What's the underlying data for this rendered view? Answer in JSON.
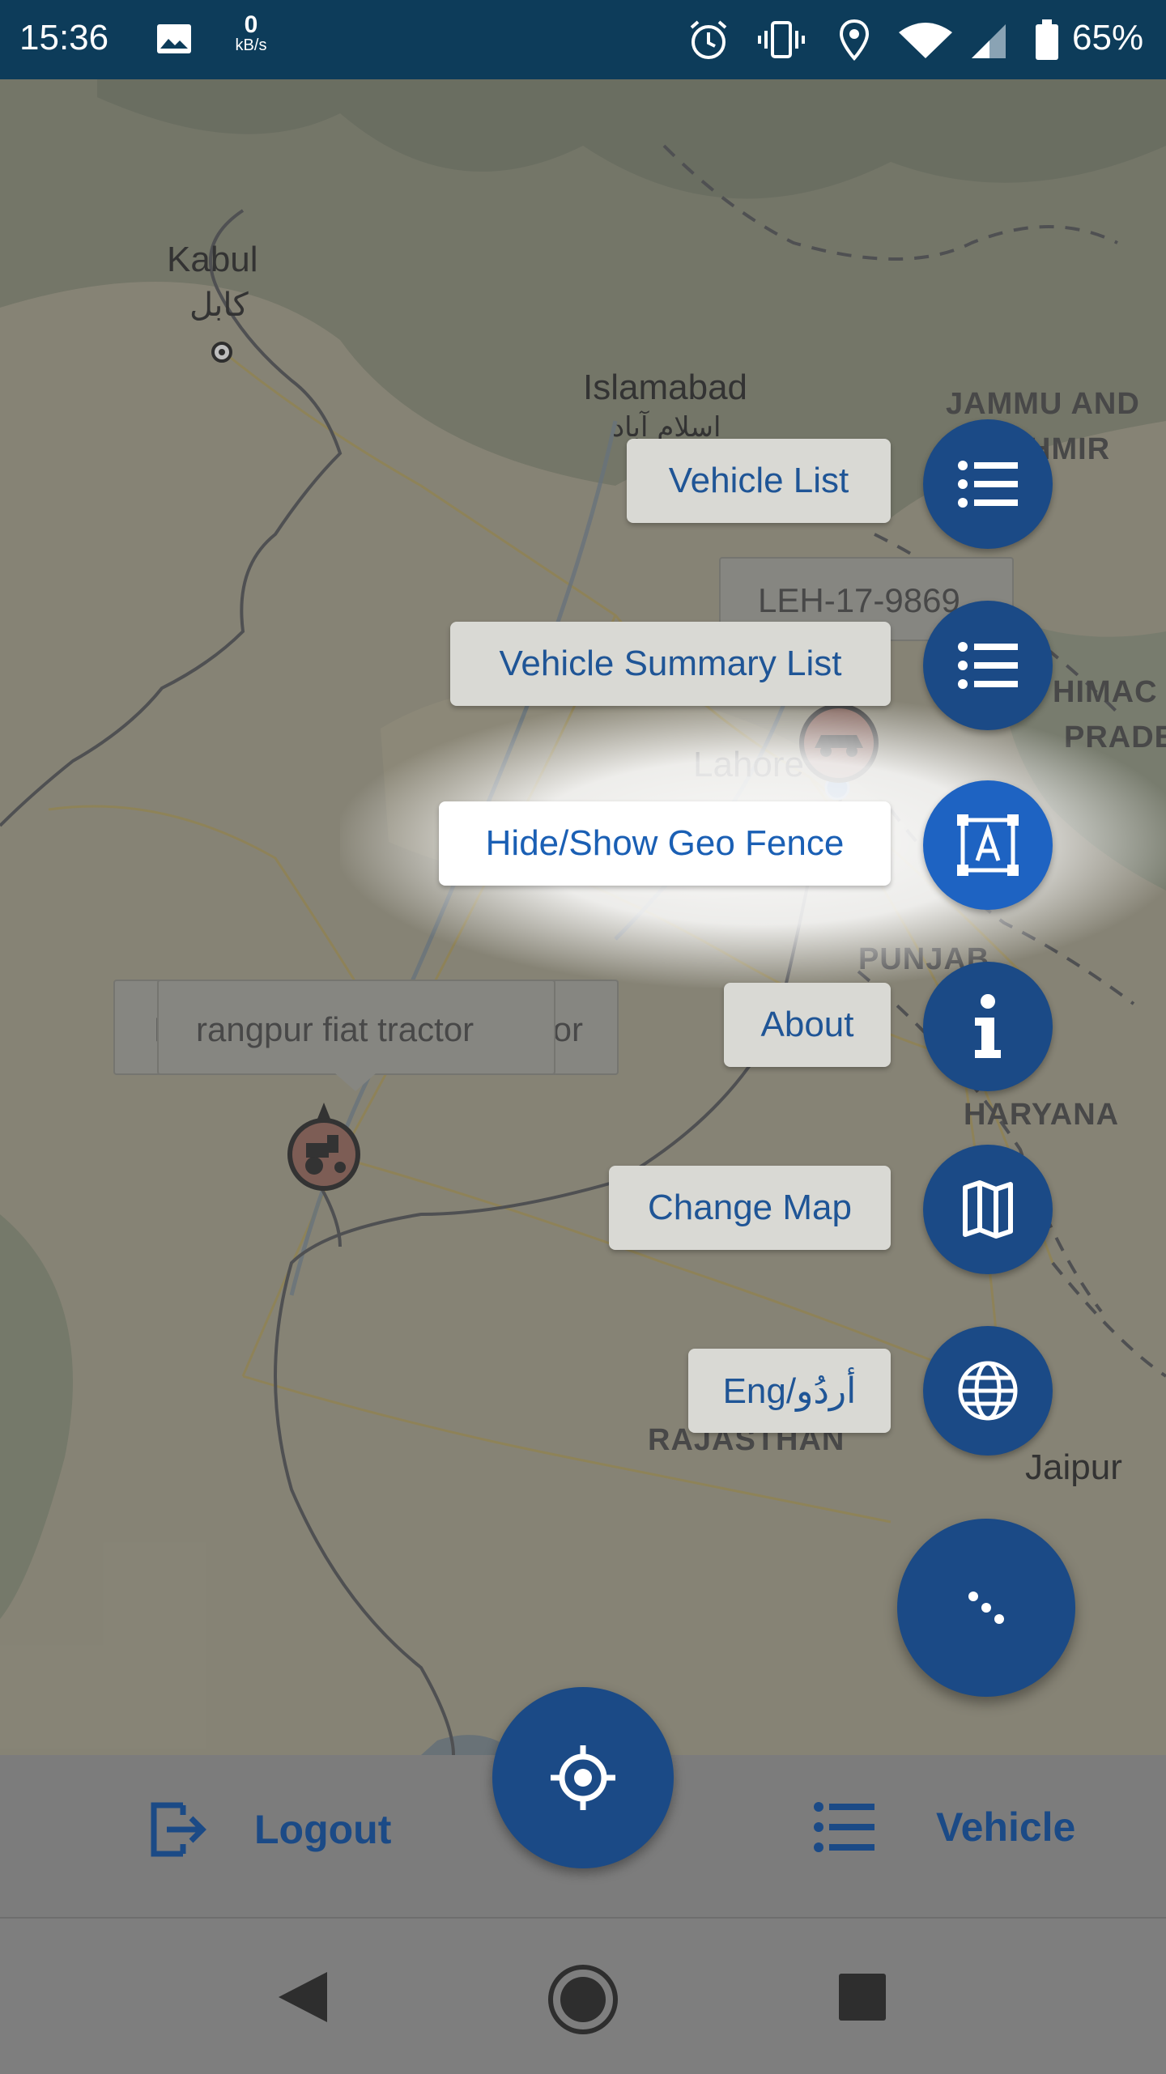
{
  "status_bar": {
    "time": "15:36",
    "net_speed_value": "0",
    "net_speed_unit": "kB/s",
    "battery": "65%",
    "icons": [
      "image-icon",
      "alarm-icon",
      "vibrate-icon",
      "location-icon",
      "wifi-icon",
      "signal-icon",
      "battery-icon"
    ]
  },
  "map": {
    "cities": {
      "kabul": "Kabul",
      "kabul_urdu": "کابل",
      "islamabad": "Islamabad",
      "islamabad_urdu": "اسلام آباد",
      "lahore": "Lahore",
      "jaipur": "Jaipur"
    },
    "regions": {
      "jammu1": "JAMMU AND",
      "jammu2": "HMIR",
      "himac1": "HIMAC",
      "himac2": "PRADE",
      "punjab": "PUNJAB",
      "haryana": "HARYANA",
      "rajasthan": "RAJASTHAN"
    },
    "vehicle_tooltip": "rangpur fiat tractor",
    "vehicle_tooltip_back_left": "F",
    "vehicle_tooltip_back_right": "or",
    "plate_tooltip": "LEH-17-9869"
  },
  "speed_dial": {
    "items": [
      {
        "label": "Vehicle List",
        "icon": "list-icon"
      },
      {
        "label": "Vehicle Summary List",
        "icon": "list-icon"
      },
      {
        "label": "Hide/Show Geo Fence",
        "icon": "geo-fence-icon"
      },
      {
        "label": "About",
        "icon": "info-icon"
      },
      {
        "label": "Change Map",
        "icon": "map-icon"
      },
      {
        "label": "Eng/أردُو",
        "icon": "globe-icon"
      }
    ],
    "highlighted": "Hide/Show Geo Fence"
  },
  "bottom_bar": {
    "logout": "Logout",
    "vehicle": "Vehicle"
  },
  "colors": {
    "primary": "#1b4a86",
    "status_bar": "#0d3c5a"
  }
}
